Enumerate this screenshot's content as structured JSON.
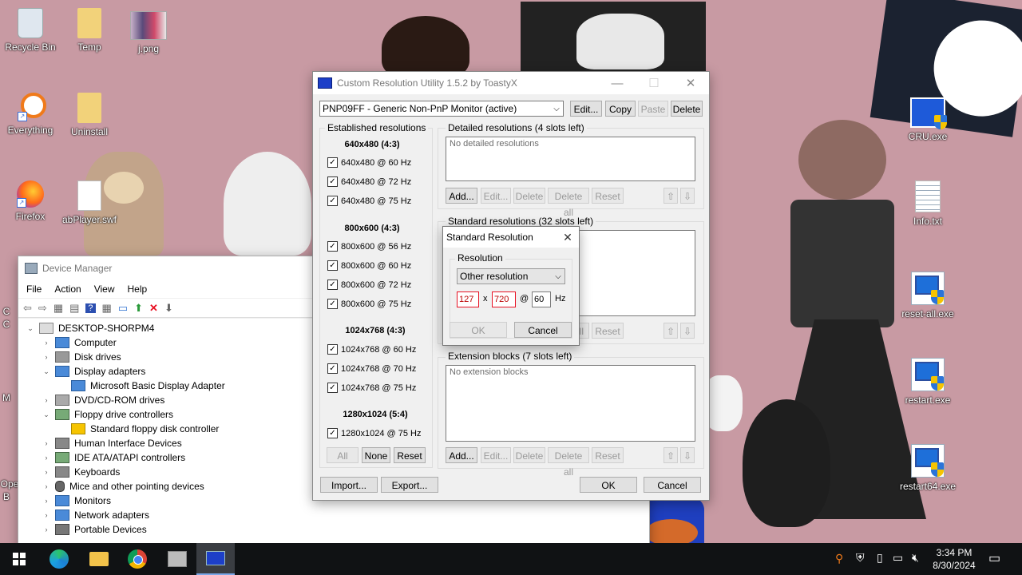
{
  "desktop": {
    "icons_left": [
      {
        "label": "Recycle Bin",
        "icon": "recycle-bin-icon"
      },
      {
        "label": "Temp",
        "icon": "folder-icon"
      },
      {
        "label": "j.png",
        "icon": "image-icon"
      },
      {
        "label": "Everything",
        "icon": "search-app-icon"
      },
      {
        "label": "Uninstall",
        "icon": "folder-icon"
      },
      {
        "label": "Firefox",
        "icon": "firefox-icon"
      },
      {
        "label": "abPlayer.swf",
        "icon": "file-icon"
      }
    ],
    "icons_right": [
      {
        "label": "CRU.exe",
        "icon": "monitor-app-icon"
      },
      {
        "label": "Info.txt",
        "icon": "text-file-icon"
      },
      {
        "label": "reset-all.exe",
        "icon": "admin-exe-icon"
      },
      {
        "label": "restart.exe",
        "icon": "admin-exe-icon"
      },
      {
        "label": "restart64.exe",
        "icon": "admin-exe-icon"
      }
    ],
    "partial_left_labels": [
      "C",
      "C",
      "M",
      "Ope",
      "B"
    ]
  },
  "cru": {
    "title": "Custom Resolution Utility 1.5.2 by ToastyX",
    "monitor_select": "PNP09FF - Generic Non-PnP Monitor (active)",
    "top_buttons": {
      "edit": "Edit...",
      "copy": "Copy",
      "paste": "Paste",
      "delete": "Delete"
    },
    "established": {
      "label": "Established resolutions",
      "groups": [
        {
          "header": "640x480 (4:3)",
          "items": [
            "640x480 @ 60 Hz",
            "640x480 @ 72 Hz",
            "640x480 @ 75 Hz"
          ]
        },
        {
          "header": "800x600 (4:3)",
          "items": [
            "800x600 @ 56 Hz",
            "800x600 @ 60 Hz",
            "800x600 @ 72 Hz",
            "800x600 @ 75 Hz"
          ]
        },
        {
          "header": "1024x768 (4:3)",
          "items": [
            "1024x768 @ 60 Hz",
            "1024x768 @ 70 Hz",
            "1024x768 @ 75 Hz"
          ]
        },
        {
          "header": "1280x1024 (5:4)",
          "items": [
            "1280x1024 @ 75 Hz"
          ]
        }
      ],
      "buttons": {
        "all": "All",
        "none": "None",
        "reset": "Reset"
      }
    },
    "detailed": {
      "label": "Detailed resolutions (4 slots left)",
      "empty": "No detailed resolutions",
      "buttons": {
        "add": "Add...",
        "edit": "Edit...",
        "delete": "Delete",
        "delete_all": "Delete all",
        "reset": "Reset"
      }
    },
    "standard": {
      "label": "Standard resolutions (32 slots left)",
      "buttons": {
        "all": "all",
        "reset": "Reset"
      }
    },
    "extension": {
      "label": "Extension blocks (7 slots left)",
      "empty": "No extension blocks",
      "buttons": {
        "add": "Add...",
        "edit": "Edit...",
        "delete": "Delete",
        "delete_all": "Delete all",
        "reset": "Reset"
      }
    },
    "bottom_buttons": {
      "import": "Import...",
      "export": "Export...",
      "ok": "OK",
      "cancel": "Cancel"
    }
  },
  "std_dialog": {
    "title": "Standard Resolution",
    "group_label": "Resolution",
    "select_value": "Other resolution",
    "width": "127",
    "x_sep": "x",
    "height": "720",
    "at_sep": "@",
    "refresh": "60",
    "hz": "Hz",
    "ok": "OK",
    "cancel": "Cancel"
  },
  "device_manager": {
    "title": "Device Manager",
    "menu": [
      "File",
      "Action",
      "View",
      "Help"
    ],
    "tree": [
      {
        "label": "DESKTOP-SHORPM4",
        "level": 0,
        "arrow": "⌄"
      },
      {
        "label": "Computer",
        "level": 1,
        "arrow": "›"
      },
      {
        "label": "Disk drives",
        "level": 1,
        "arrow": "›"
      },
      {
        "label": "Display adapters",
        "level": 1,
        "arrow": "⌄"
      },
      {
        "label": "Microsoft Basic Display Adapter",
        "level": 2,
        "arrow": ""
      },
      {
        "label": "DVD/CD-ROM drives",
        "level": 1,
        "arrow": "›"
      },
      {
        "label": "Floppy drive controllers",
        "level": 1,
        "arrow": "⌄"
      },
      {
        "label": "Standard floppy disk controller",
        "level": 2,
        "arrow": ""
      },
      {
        "label": "Human Interface Devices",
        "level": 1,
        "arrow": "›"
      },
      {
        "label": "IDE ATA/ATAPI controllers",
        "level": 1,
        "arrow": "›"
      },
      {
        "label": "Keyboards",
        "level": 1,
        "arrow": "›"
      },
      {
        "label": "Mice and other pointing devices",
        "level": 1,
        "arrow": "›"
      },
      {
        "label": "Monitors",
        "level": 1,
        "arrow": "›"
      },
      {
        "label": "Network adapters",
        "level": 1,
        "arrow": "›"
      },
      {
        "label": "Portable Devices",
        "level": 1,
        "arrow": "›"
      }
    ]
  },
  "taskbar": {
    "time": "3:34 PM",
    "date": "8/30/2024"
  },
  "colors": {
    "desktop_bg": "#c89aa3",
    "window_bg": "#f0f0f0",
    "accent_blue": "#1d3fc8",
    "error_red": "#e81123"
  }
}
